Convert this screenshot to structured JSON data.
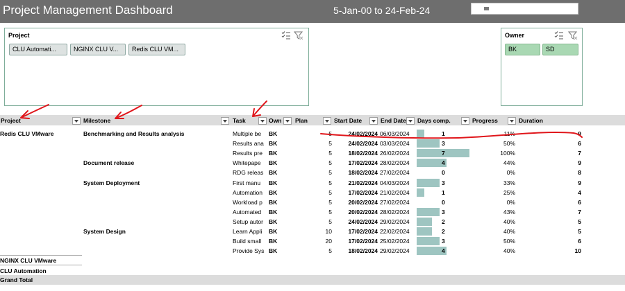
{
  "header": {
    "title": "Project Management Dashboard",
    "date_range": "5-Jan-00 to 24-Feb-24"
  },
  "project_slicer": {
    "title": "Project",
    "items": [
      "CLU Automati...",
      "NGINX CLU V...",
      "Redis CLU VM..."
    ]
  },
  "owner_slicer": {
    "title": "Owner",
    "items": [
      "BK",
      "SD"
    ]
  },
  "table": {
    "columns": {
      "project": "Project",
      "milestone": "Milestone",
      "task": "Task",
      "owner": "Own",
      "plan": "Plan",
      "start": "Start Date",
      "end": "End Date",
      "days": "Days comp.",
      "progress": "Progress",
      "duration": "Duration"
    },
    "project": "Redis CLU VMware",
    "milestones": [
      {
        "name": "Benchmarking and Results analysis",
        "row": 0
      },
      {
        "name": "Document release",
        "row": 3
      },
      {
        "name": "System Deployment",
        "row": 5
      },
      {
        "name": "System Design",
        "row": 10
      }
    ],
    "rows": [
      {
        "task": "Multiple be",
        "owner": "BK",
        "plan": "5",
        "start": "24/02/2024",
        "end": "06/03/2024",
        "days": 1,
        "progress": "11%",
        "duration": "9",
        "start_bold": true,
        "end_bold": false
      },
      {
        "task": "Results ana",
        "owner": "BK",
        "plan": "5",
        "start": "24/02/2024",
        "end": "03/03/2024",
        "days": 3,
        "progress": "50%",
        "duration": "6",
        "start_bold": true,
        "end_bold": false
      },
      {
        "task": "Results pre",
        "owner": "BK",
        "plan": "5",
        "start": "18/02/2024",
        "end": "26/02/2024",
        "days": 7,
        "progress": "100%",
        "duration": "7",
        "start_bold": true,
        "end_bold": false
      },
      {
        "task": "Whitepape",
        "owner": "BK",
        "plan": "5",
        "start": "17/02/2024",
        "end": "28/02/2024",
        "days": 4,
        "progress": "44%",
        "duration": "9",
        "start_bold": true,
        "end_bold": false
      },
      {
        "task": "RDG releas",
        "owner": "BK",
        "plan": "5",
        "start": "18/02/2024",
        "end": "27/02/2024",
        "days": 0,
        "progress": "0%",
        "duration": "8",
        "start_bold": true,
        "end_bold": false
      },
      {
        "task": "First manu",
        "owner": "BK",
        "plan": "5",
        "start": "21/02/2024",
        "end": "04/03/2024",
        "days": 3,
        "progress": "33%",
        "duration": "9",
        "start_bold": true,
        "end_bold": false
      },
      {
        "task": "Automation",
        "owner": "BK",
        "plan": "5",
        "start": "17/02/2024",
        "end": "21/02/2024",
        "days": 1,
        "progress": "25%",
        "duration": "4",
        "start_bold": true,
        "end_bold": false
      },
      {
        "task": "Workload p",
        "owner": "BK",
        "plan": "5",
        "start": "20/02/2024",
        "end": "27/02/2024",
        "days": 0,
        "progress": "0%",
        "duration": "6",
        "start_bold": true,
        "end_bold": false
      },
      {
        "task": "Automated",
        "owner": "BK",
        "plan": "5",
        "start": "20/02/2024",
        "end": "28/02/2024",
        "days": 3,
        "progress": "43%",
        "duration": "7",
        "start_bold": true,
        "end_bold": false
      },
      {
        "task": "Setup autor",
        "owner": "BK",
        "plan": "5",
        "start": "24/02/2024",
        "end": "29/02/2024",
        "days": 2,
        "progress": "40%",
        "duration": "5",
        "start_bold": true,
        "end_bold": false
      },
      {
        "task": "Learn Appli",
        "owner": "BK",
        "plan": "10",
        "start": "17/02/2024",
        "end": "22/02/2024",
        "days": 2,
        "progress": "40%",
        "duration": "5",
        "start_bold": true,
        "end_bold": false
      },
      {
        "task": "Build small",
        "owner": "BK",
        "plan": "20",
        "start": "17/02/2024",
        "end": "25/02/2024",
        "days": 3,
        "progress": "50%",
        "duration": "6",
        "start_bold": true,
        "end_bold": false
      },
      {
        "task": "Provide Sys",
        "owner": "BK",
        "plan": "5",
        "start": "18/02/2024",
        "end": "29/02/2024",
        "days": 4,
        "progress": "40%",
        "duration": "10",
        "start_bold": true,
        "end_bold": false
      }
    ],
    "days_scale_max": 7,
    "subtotals": [
      "NGINX CLU VMware",
      "CLU Automation"
    ],
    "grand_total": "Grand Total"
  },
  "colors": {
    "header_bg": "#6e6e6e",
    "slicer_border": "#7fae9a",
    "owner_chip": "#a9d8b3",
    "data_bar": "#9ec5c1",
    "annotation": "#e0161b"
  }
}
